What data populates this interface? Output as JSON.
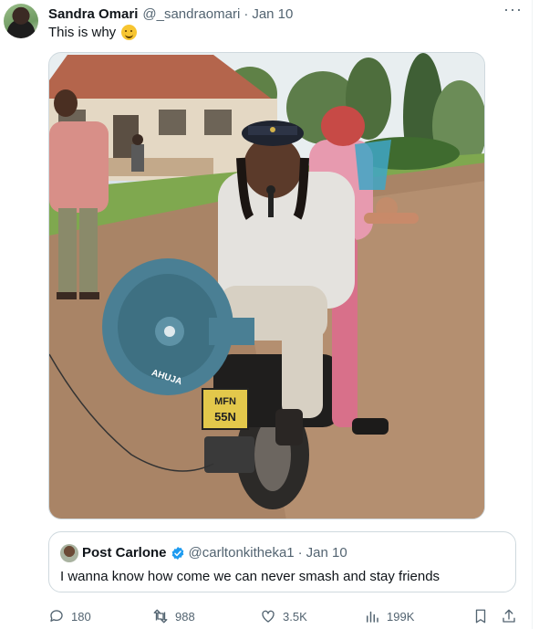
{
  "tweet": {
    "author_name": "Sandra Omari",
    "handle": "@_sandraomari",
    "separator": "·",
    "time": "Jan 10",
    "text": "This is why",
    "more_label": "···",
    "emoji": "upside-down-smile-emoji",
    "image_text": {
      "speaker_brand": "AHUJA",
      "plate": "MFN 55N"
    }
  },
  "quote": {
    "author_name": "Post Carlone",
    "handle": "@carltonkitheka1",
    "separator": "·",
    "time": "Jan 10",
    "text": "I wanna know how come we can never smash and stay friends"
  },
  "actions": {
    "reply_count": "180",
    "retweet_count": "988",
    "like_count": "3.5K",
    "view_count": "199K"
  },
  "colors": {
    "text": "#0f1419",
    "secondary": "#536471",
    "border": "#cfd9de",
    "verified": "#1d9bf0"
  }
}
